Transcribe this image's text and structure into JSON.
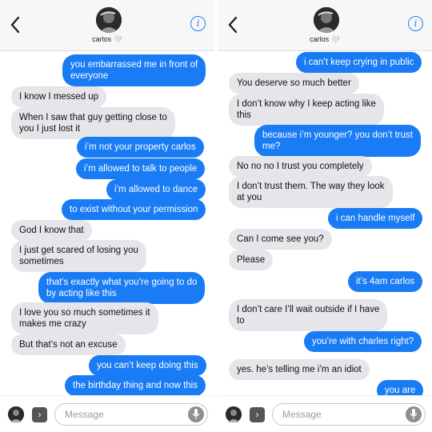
{
  "colors": {
    "outgoing": "#1a7cf5",
    "incoming": "#e5e5ea",
    "accent": "#1a7cf5"
  },
  "left": {
    "contact_name": "carlos 🤍",
    "info_label": "i",
    "composer_placeholder": "Message",
    "messages": [
      {
        "dir": "out",
        "text": "you embarrassed me in front of\neveryone"
      },
      {
        "dir": "in",
        "text": "I know I messed up"
      },
      {
        "dir": "in",
        "text": "When I saw that guy getting close to\nyou I just lost it"
      },
      {
        "dir": "out",
        "text": "i’m not your property carlos"
      },
      {
        "dir": "out",
        "text": "i’m allowed to talk to people"
      },
      {
        "dir": "out",
        "text": "i’m allowed to dance"
      },
      {
        "dir": "out",
        "text": "to exist without your permission"
      },
      {
        "dir": "in",
        "text": "God I know that"
      },
      {
        "dir": "in",
        "text": "I just get scared of losing you\nsometimes"
      },
      {
        "dir": "out",
        "text": "that’s exactly what you’re going to do\nby acting like this"
      },
      {
        "dir": "in",
        "text": "I love you so much sometimes it\nmakes me crazy"
      },
      {
        "dir": "in",
        "text": "But that’s not an excuse"
      },
      {
        "dir": "out",
        "text": "you can’t keep doing this"
      },
      {
        "dir": "out",
        "text": "the birthday thing and now this"
      }
    ]
  },
  "right": {
    "contact_name": "carlos 🤍",
    "info_label": "i",
    "composer_placeholder": "Message",
    "messages": [
      {
        "dir": "out",
        "text": "i can’t keep crying in public"
      },
      {
        "dir": "in",
        "text": "You deserve so much better"
      },
      {
        "dir": "in",
        "text": "I don’t know why I keep acting like\nthis"
      },
      {
        "dir": "out",
        "text": "because i’m younger? you don’t trust\nme?"
      },
      {
        "dir": "in",
        "text": "No no no I trust you completely"
      },
      {
        "dir": "in",
        "text": "I don’t trust them. The way they look\nat you"
      },
      {
        "dir": "out",
        "text": "i can handle myself"
      },
      {
        "dir": "in",
        "text": "Can I come see you?"
      },
      {
        "dir": "in",
        "text": "Please"
      },
      {
        "dir": "out",
        "text": "it’s 4am carlos"
      },
      {
        "dir": "in",
        "text": "I don’t care I’ll wait outside if I have\nto"
      },
      {
        "dir": "out",
        "text": "you’re with charles right?"
      },
      {
        "dir": "in",
        "text": "yes. he’s telling me i’m an idiot"
      },
      {
        "dir": "out",
        "text": "you are"
      }
    ]
  }
}
